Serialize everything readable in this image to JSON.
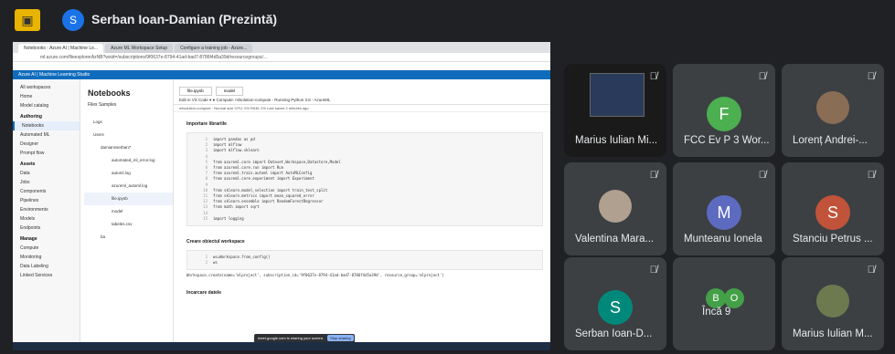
{
  "meet": {
    "presenter_initial": "S",
    "title": "Serban Ioan-Damian (Prezintă)"
  },
  "browser": {
    "tabs": [
      "Notebooks - Azure AI | Machine Le...",
      "Azure ML Workspace Setup",
      "Configure a training job - Azure..."
    ],
    "address": "ml.azure.com/fileexplorerAzNB?wsid=/subscriptions/9f0637e-8794-41ad-bad7-8786f4d5a39d/resourcegroups/..."
  },
  "azure": {
    "app_title": "Azure AI | Machine Learning Studio",
    "breadcrumb": "Default Directory > mlproject > Notebooks",
    "nav_items": [
      {
        "label": "All workspaces",
        "section": false
      },
      {
        "label": "Home",
        "section": false
      },
      {
        "label": "Model catalog",
        "section": false
      },
      {
        "label": "Authoring",
        "section": true
      },
      {
        "label": "Notebooks",
        "section": false,
        "active": true
      },
      {
        "label": "Automated ML",
        "section": false
      },
      {
        "label": "Designer",
        "section": false
      },
      {
        "label": "Prompt flow",
        "section": false
      },
      {
        "label": "Assets",
        "section": true
      },
      {
        "label": "Data",
        "section": false
      },
      {
        "label": "Jobs",
        "section": false
      },
      {
        "label": "Components",
        "section": false
      },
      {
        "label": "Pipelines",
        "section": false
      },
      {
        "label": "Environments",
        "section": false
      },
      {
        "label": "Models",
        "section": false
      },
      {
        "label": "Endpoints",
        "section": false
      },
      {
        "label": "Manage",
        "section": true
      },
      {
        "label": "Compute",
        "section": false
      },
      {
        "label": "Monitoring",
        "section": false
      },
      {
        "label": "Data Labeling",
        "section": false
      },
      {
        "label": "Linked Services",
        "section": false
      }
    ],
    "files_title": "Notebooks",
    "files_tabs": "Files   Samples",
    "tree": [
      {
        "label": "Logs",
        "indent": 10
      },
      {
        "label": "Users",
        "indent": 10
      },
      {
        "label": "damiansserban7",
        "indent": 18
      },
      {
        "label": "automated_ml_error.log",
        "indent": 30
      },
      {
        "label": "automl.log",
        "indent": 30
      },
      {
        "label": "azureml_automl.log",
        "indent": 30
      },
      {
        "label": "file.ipynb",
        "indent": 30,
        "selected": true
      },
      {
        "label": "model",
        "indent": 30
      },
      {
        "label": "tabeles.csv",
        "indent": 30
      },
      {
        "label": "ba",
        "indent": 18
      }
    ],
    "editor_tabs": [
      "file.ipynb",
      "model"
    ],
    "toolbar": "Edit in VS Code  ▾   ● Compute:  mlsolution-compute  -  Running        Python 3.8 - AzureML",
    "status": "mlsolution-compute · Normal size   CPU: 0%   RAM: 2%         Last saved 2 minutes ago",
    "md_import": "Importare librariile",
    "code_import": [
      "import pandas as pd",
      "import mlflow",
      "import mlflow.sklearn",
      "",
      "from azureml.core import Dataset,Workspace,Datastore,Model",
      "from azureml.core.run import Run",
      "from azureml.train.automl import AutoMLConfig",
      "from azureml.core.experiment import Experiment",
      "",
      "from sklearn.model_selection import train_test_split",
      "from sklearn.metrics import mean_squared_error",
      "from sklearn.ensemble import RandomForestRegressor",
      "from math import sqrt",
      "",
      "import logging"
    ],
    "md_workspace": "Creare obiectul workspace",
    "code_workspace": [
      "ws=Workspace.from_config()",
      "ws"
    ],
    "output_workspace": "Workspace.create(name='mlproject', subscription_id='9f0637e-8794-41ad-bad7-8786f4d5a39d', resource_group='mlproject')",
    "md_next": "Incarcare datele",
    "share_text": "meet.google.com is sharing your screen.",
    "share_stop": "Stop sharing",
    "share_hide": "Hide"
  },
  "participants": [
    {
      "name": "Marius Iulian Mi...",
      "kind": "video",
      "muted": true
    },
    {
      "name": "FCC Ev P 3 Wor...",
      "kind": "initial",
      "initial": "F",
      "color": "#4caf50",
      "muted": true
    },
    {
      "name": "Lorenț Andrei-...",
      "kind": "photo",
      "color": "#8a6d55",
      "muted": true
    },
    {
      "name": "Valentina Mara...",
      "kind": "photo",
      "color": "#b0a090",
      "muted": true
    },
    {
      "name": "Munteanu Ionela",
      "kind": "initial",
      "initial": "M",
      "color": "#5c6bc0",
      "muted": true
    },
    {
      "name": "Stanciu Petrus ...",
      "kind": "initial",
      "initial": "S",
      "color": "#c0533a",
      "muted": true
    },
    {
      "name": "Serban Ioan-D...",
      "kind": "initial",
      "initial": "S",
      "color": "#00897b",
      "muted": true
    },
    {
      "name": "Încă 9",
      "kind": "more",
      "initials": [
        "B",
        "O"
      ],
      "colors": [
        "#43a047",
        "#43a047"
      ],
      "muted": false
    },
    {
      "name": "Marius Iulian M...",
      "kind": "photo",
      "color": "#6d7a50",
      "muted": true
    }
  ]
}
